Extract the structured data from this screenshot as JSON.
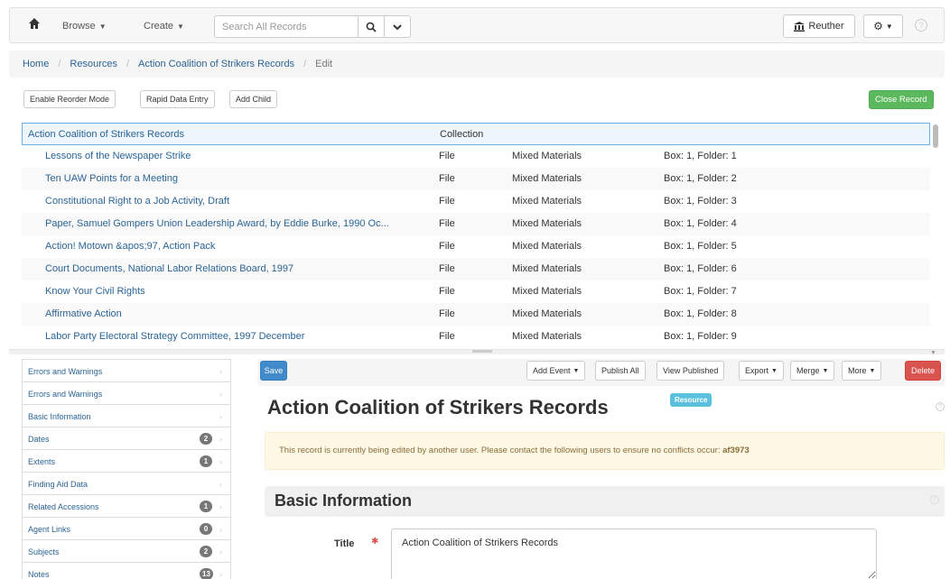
{
  "nav": {
    "browse_label": "Browse",
    "create_label": "Create",
    "search_placeholder": "Search All Records",
    "repository_label": "Reuther"
  },
  "breadcrumb": [
    "Home",
    "Resources",
    "Action Coalition of Strikers Records",
    "Edit"
  ],
  "toolbar": {
    "reorder_label": "Enable Reorder Mode",
    "rde_label": "Rapid Data Entry",
    "add_child_label": "Add Child",
    "close_label": "Close Record"
  },
  "tree": {
    "root": {
      "title": "Action Coalition of Strikers Records",
      "level": "Collection"
    },
    "rows": [
      {
        "title": "Lessons of the Newspaper Strike",
        "level": "File",
        "type": "Mixed Materials",
        "container": "Box: 1, Folder: 1"
      },
      {
        "title": "Ten UAW Points for a Meeting",
        "level": "File",
        "type": "Mixed Materials",
        "container": "Box: 1, Folder: 2"
      },
      {
        "title": "Constitutional Right to a Job Activity, Draft",
        "level": "File",
        "type": "Mixed Materials",
        "container": "Box: 1, Folder: 3"
      },
      {
        "title": "Paper, Samuel Gompers Union Leadership Award, by Eddie Burke, 1990 Oc...",
        "level": "File",
        "type": "Mixed Materials",
        "container": "Box: 1, Folder: 4"
      },
      {
        "title": "Action! Motown &apos;97, Action Pack",
        "level": "File",
        "type": "Mixed Materials",
        "container": "Box: 1, Folder: 5"
      },
      {
        "title": "Court Documents, National Labor Relations Board, 1997",
        "level": "File",
        "type": "Mixed Materials",
        "container": "Box: 1, Folder: 6"
      },
      {
        "title": "Know Your Civil Rights",
        "level": "File",
        "type": "Mixed Materials",
        "container": "Box: 1, Folder: 7"
      },
      {
        "title": "Affirmative Action",
        "level": "File",
        "type": "Mixed Materials",
        "container": "Box: 1, Folder: 8"
      },
      {
        "title": "Labor Party Electoral Strategy Committee, 1997 December",
        "level": "File",
        "type": "Mixed Materials",
        "container": "Box: 1, Folder: 9"
      }
    ]
  },
  "sidebar": {
    "items": [
      {
        "label": "Errors and Warnings",
        "count": ""
      },
      {
        "label": "Errors and Warnings",
        "count": ""
      },
      {
        "label": "Basic Information",
        "count": ""
      },
      {
        "label": "Dates",
        "count": "2"
      },
      {
        "label": "Extents",
        "count": "1"
      },
      {
        "label": "Finding Aid Data",
        "count": ""
      },
      {
        "label": "Related Accessions",
        "count": "1"
      },
      {
        "label": "Agent Links",
        "count": "0"
      },
      {
        "label": "Subjects",
        "count": "2"
      },
      {
        "label": "Notes",
        "count": "13"
      }
    ]
  },
  "record_toolbar": {
    "save_label": "Save",
    "add_event_label": "Add Event",
    "publish_all_label": "Publish All",
    "view_published_label": "View Published",
    "export_label": "Export",
    "merge_label": "Merge",
    "more_label": "More",
    "delete_label": "Delete"
  },
  "record": {
    "title": "Action Coalition of Strikers Records",
    "type_label": "Resource",
    "warning_text": "This record is currently being edited by another user. Please contact the following users to ensure no conflicts occur:",
    "warning_user": "af3973",
    "section_title": "Basic Information",
    "title_field_label": "Title",
    "title_field_value": "Action Coalition of Strikers Records"
  },
  "colors": {
    "primary": "#428bca",
    "success": "#5cb85c",
    "danger": "#d9534f",
    "info": "#5bc0de",
    "link": "#2a6496"
  }
}
